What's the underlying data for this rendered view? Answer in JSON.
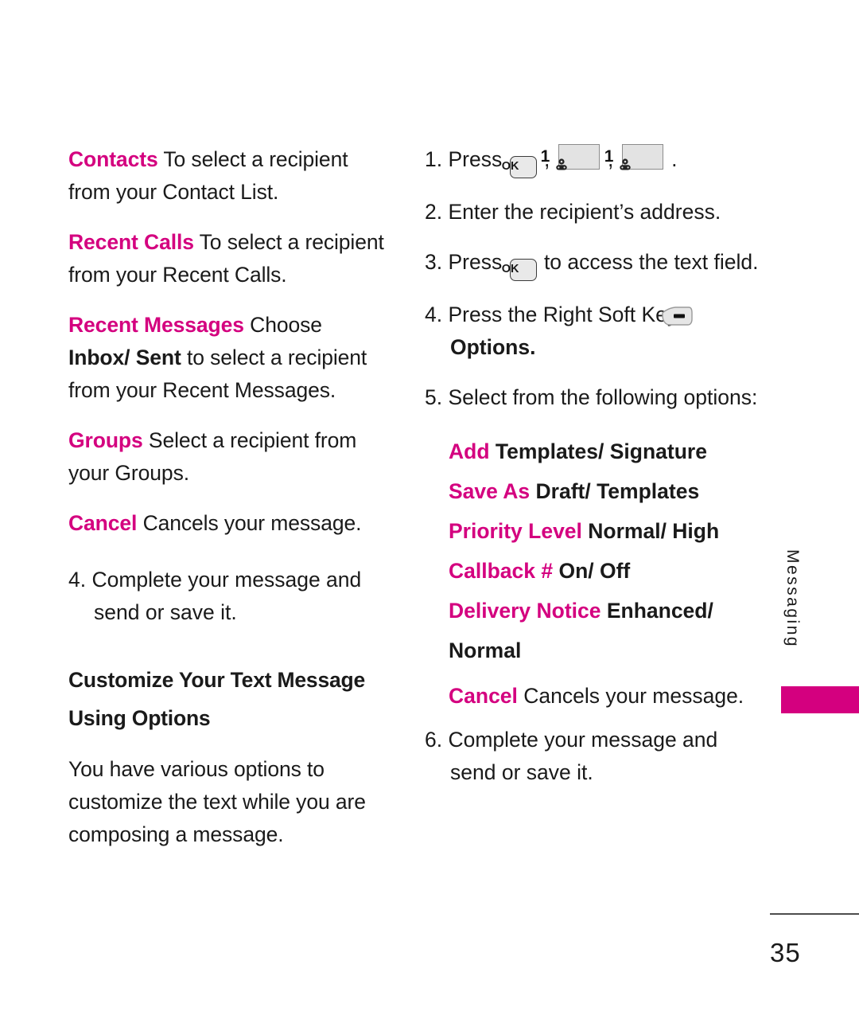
{
  "document": {
    "page_number": "35",
    "side_tab_label": "Messaging",
    "accent_color": "#d4007f",
    "text_color": "#1a1a1a"
  },
  "left_column": {
    "entries": [
      {
        "term": "Contacts",
        "rest": " To select a recipient from your Contact List."
      },
      {
        "term": "Recent Calls",
        "rest": " To select a recipient from your Recent Calls."
      },
      {
        "term": "Recent Messages",
        "rest_1": " Choose ",
        "bold": "Inbox/ Sent",
        "rest_2": " to select a recipient from your Recent Messages."
      },
      {
        "term": "Groups",
        "rest": " Select a recipient from your Groups."
      },
      {
        "term": "Cancel",
        "rest": " Cancels your message."
      }
    ],
    "step_4": "4. Complete your message and send or save it.",
    "heading": "Customize Your Text Message Using Options",
    "body": "You have various options to customize the text while you are composing a message."
  },
  "right_column": {
    "step_1": {
      "prefix": "1. Press ",
      "key_ok_label": "OK",
      "sep_1": " , ",
      "key_num_label": "1",
      "sep_2": " , ",
      "suffix": " ."
    },
    "step_2": "2. Enter the recipient’s address.",
    "step_3": {
      "prefix": "3. Press ",
      "key_ok_label": "OK",
      "suffix": " to access the text field."
    },
    "step_4": {
      "prefix": "4. Press the Right Soft Key ",
      "bold_suffix": "Options",
      "period": "."
    },
    "step_5_intro": "5. Select from the following options:",
    "options": [
      {
        "term": "Add",
        "values": " Templates/ Signature"
      },
      {
        "term": "Save As",
        "values": "  Draft/ Templates"
      },
      {
        "term": "Priority Level",
        "values": " Normal/ High"
      },
      {
        "term": "Callback #",
        "values": " On/ Off"
      },
      {
        "term": "Delivery Notice",
        "values": " Enhanced/ Normal"
      }
    ],
    "option_cancel": {
      "term": "Cancel",
      "rest": " Cancels your message."
    },
    "step_6": "6. Complete your message and send or save it."
  },
  "icons": {
    "ok_key": "ok-key-icon",
    "number_one_key": "number-one-key-icon",
    "right_soft_key": "right-soft-key-icon"
  }
}
